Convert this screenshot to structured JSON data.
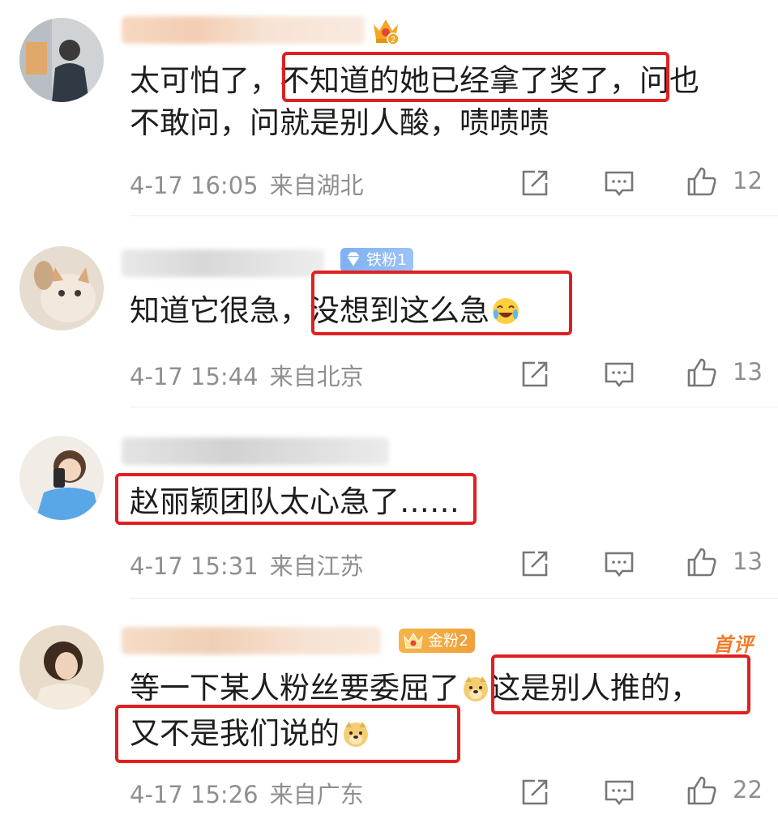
{
  "comments": [
    {
      "level_badge": "2",
      "line1_pre": "太可怕了，",
      "line1_hl": "不知道的她已经拿了奖了",
      "line1_post": "，问也",
      "line2": "不敢问，问就是别人酸，啧啧啧",
      "time": "4-17 16:05",
      "location": "来自湖北",
      "likes": "12"
    },
    {
      "badge": "铁粉1",
      "line1_pre": "知道它很急，",
      "line1_hl": "没想到这么急",
      "emoji": "laugh-cry-emoji",
      "time": "4-17 15:44",
      "location": "来自北京",
      "likes": "13"
    },
    {
      "line1_hl": "赵丽颖团队太心急了……",
      "time": "4-17 15:31",
      "location": "来自江苏",
      "likes": "13"
    },
    {
      "badge": "金粉2",
      "first_tag": "首评",
      "line1_pre": "等一下某人粉丝要委屈了",
      "line1_hl": "这是别人推的，",
      "line2": "又不是我们说的",
      "emoji": "doge-emoji",
      "time": "4-17 15:26",
      "location": "来自广东",
      "likes": "22"
    }
  ],
  "colors": {
    "highlight_box": "#e02020",
    "meta_text": "#8f8f8f",
    "body_text": "#1d1d1d",
    "iron_badge": "#8ab8f4",
    "gold_badge": "#f2a83f",
    "first_tag": "#f37a2a"
  }
}
